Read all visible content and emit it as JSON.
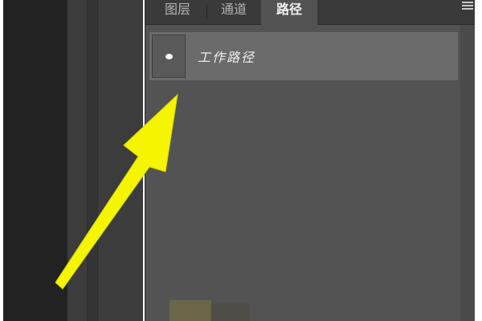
{
  "panel": {
    "tabs": [
      {
        "label": "图层"
      },
      {
        "label": "通道"
      },
      {
        "label": "路径"
      }
    ],
    "active_tab": "路径",
    "menu_icon": "hamburger-menu-icon"
  },
  "paths": {
    "items": [
      {
        "label": "工作路径",
        "icon": "path-thumbnail-icon"
      }
    ]
  },
  "annotation": {
    "arrow_color": "#f5f500",
    "icon": "arrow-annotation-icon"
  },
  "colors": {
    "panel_bg": "#535353",
    "tabbar_bg": "#3a3a3a",
    "row_bg": "#6b6b6b",
    "left_dark": "#222222"
  }
}
